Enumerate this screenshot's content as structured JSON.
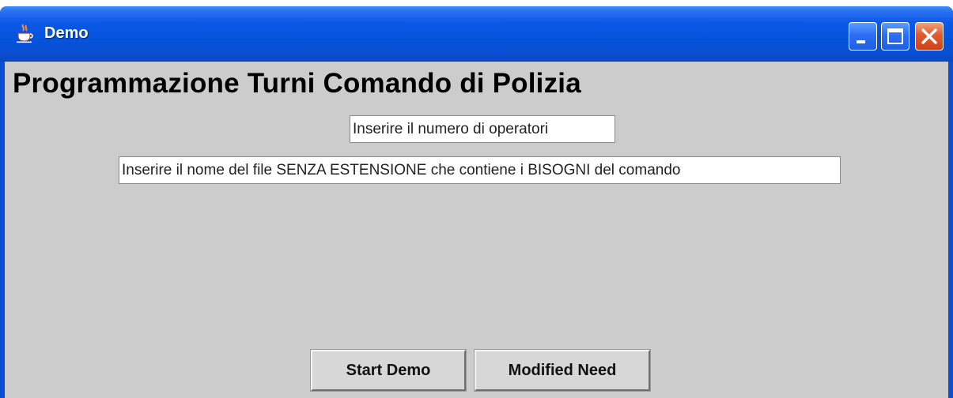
{
  "window": {
    "title": "Demo",
    "icon": "java-cup-icon",
    "controls": [
      "minimize-icon",
      "maximize-icon",
      "close-icon"
    ]
  },
  "main": {
    "heading": "Programmazione Turni Comando di Polizia",
    "operators_field": {
      "value": "Inserire il numero di operatori"
    },
    "file_field": {
      "value": "Inserire il nome del file SENZA ESTENSIONE che contiene i BISOGNI del comando"
    }
  },
  "buttons": {
    "start_label": "Start Demo",
    "modified_label": "Modified Need"
  },
  "colors": {
    "titlebar": "#0552da",
    "content_background": "#cccccc",
    "close_button": "#e2592f"
  }
}
